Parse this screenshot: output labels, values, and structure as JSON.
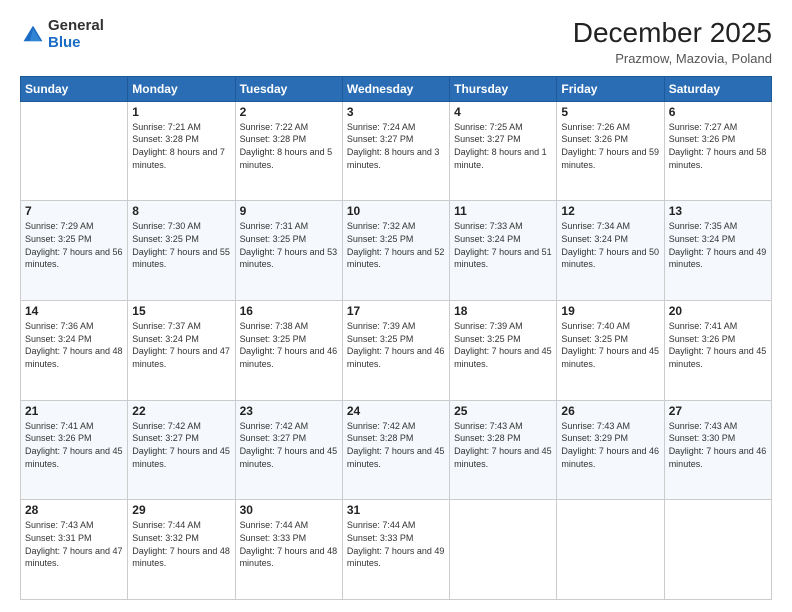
{
  "logo": {
    "general": "General",
    "blue": "Blue"
  },
  "title": "December 2025",
  "subtitle": "Prazmow, Mazovia, Poland",
  "days": [
    "Sunday",
    "Monday",
    "Tuesday",
    "Wednesday",
    "Thursday",
    "Friday",
    "Saturday"
  ],
  "weeks": [
    [
      {
        "day": "",
        "sunrise": "",
        "sunset": "",
        "daylight": ""
      },
      {
        "day": "1",
        "sunrise": "Sunrise: 7:21 AM",
        "sunset": "Sunset: 3:28 PM",
        "daylight": "Daylight: 8 hours and 7 minutes."
      },
      {
        "day": "2",
        "sunrise": "Sunrise: 7:22 AM",
        "sunset": "Sunset: 3:28 PM",
        "daylight": "Daylight: 8 hours and 5 minutes."
      },
      {
        "day": "3",
        "sunrise": "Sunrise: 7:24 AM",
        "sunset": "Sunset: 3:27 PM",
        "daylight": "Daylight: 8 hours and 3 minutes."
      },
      {
        "day": "4",
        "sunrise": "Sunrise: 7:25 AM",
        "sunset": "Sunset: 3:27 PM",
        "daylight": "Daylight: 8 hours and 1 minute."
      },
      {
        "day": "5",
        "sunrise": "Sunrise: 7:26 AM",
        "sunset": "Sunset: 3:26 PM",
        "daylight": "Daylight: 7 hours and 59 minutes."
      },
      {
        "day": "6",
        "sunrise": "Sunrise: 7:27 AM",
        "sunset": "Sunset: 3:26 PM",
        "daylight": "Daylight: 7 hours and 58 minutes."
      }
    ],
    [
      {
        "day": "7",
        "sunrise": "Sunrise: 7:29 AM",
        "sunset": "Sunset: 3:25 PM",
        "daylight": "Daylight: 7 hours and 56 minutes."
      },
      {
        "day": "8",
        "sunrise": "Sunrise: 7:30 AM",
        "sunset": "Sunset: 3:25 PM",
        "daylight": "Daylight: 7 hours and 55 minutes."
      },
      {
        "day": "9",
        "sunrise": "Sunrise: 7:31 AM",
        "sunset": "Sunset: 3:25 PM",
        "daylight": "Daylight: 7 hours and 53 minutes."
      },
      {
        "day": "10",
        "sunrise": "Sunrise: 7:32 AM",
        "sunset": "Sunset: 3:25 PM",
        "daylight": "Daylight: 7 hours and 52 minutes."
      },
      {
        "day": "11",
        "sunrise": "Sunrise: 7:33 AM",
        "sunset": "Sunset: 3:24 PM",
        "daylight": "Daylight: 7 hours and 51 minutes."
      },
      {
        "day": "12",
        "sunrise": "Sunrise: 7:34 AM",
        "sunset": "Sunset: 3:24 PM",
        "daylight": "Daylight: 7 hours and 50 minutes."
      },
      {
        "day": "13",
        "sunrise": "Sunrise: 7:35 AM",
        "sunset": "Sunset: 3:24 PM",
        "daylight": "Daylight: 7 hours and 49 minutes."
      }
    ],
    [
      {
        "day": "14",
        "sunrise": "Sunrise: 7:36 AM",
        "sunset": "Sunset: 3:24 PM",
        "daylight": "Daylight: 7 hours and 48 minutes."
      },
      {
        "day": "15",
        "sunrise": "Sunrise: 7:37 AM",
        "sunset": "Sunset: 3:24 PM",
        "daylight": "Daylight: 7 hours and 47 minutes."
      },
      {
        "day": "16",
        "sunrise": "Sunrise: 7:38 AM",
        "sunset": "Sunset: 3:25 PM",
        "daylight": "Daylight: 7 hours and 46 minutes."
      },
      {
        "day": "17",
        "sunrise": "Sunrise: 7:39 AM",
        "sunset": "Sunset: 3:25 PM",
        "daylight": "Daylight: 7 hours and 46 minutes."
      },
      {
        "day": "18",
        "sunrise": "Sunrise: 7:39 AM",
        "sunset": "Sunset: 3:25 PM",
        "daylight": "Daylight: 7 hours and 45 minutes."
      },
      {
        "day": "19",
        "sunrise": "Sunrise: 7:40 AM",
        "sunset": "Sunset: 3:25 PM",
        "daylight": "Daylight: 7 hours and 45 minutes."
      },
      {
        "day": "20",
        "sunrise": "Sunrise: 7:41 AM",
        "sunset": "Sunset: 3:26 PM",
        "daylight": "Daylight: 7 hours and 45 minutes."
      }
    ],
    [
      {
        "day": "21",
        "sunrise": "Sunrise: 7:41 AM",
        "sunset": "Sunset: 3:26 PM",
        "daylight": "Daylight: 7 hours and 45 minutes."
      },
      {
        "day": "22",
        "sunrise": "Sunrise: 7:42 AM",
        "sunset": "Sunset: 3:27 PM",
        "daylight": "Daylight: 7 hours and 45 minutes."
      },
      {
        "day": "23",
        "sunrise": "Sunrise: 7:42 AM",
        "sunset": "Sunset: 3:27 PM",
        "daylight": "Daylight: 7 hours and 45 minutes."
      },
      {
        "day": "24",
        "sunrise": "Sunrise: 7:42 AM",
        "sunset": "Sunset: 3:28 PM",
        "daylight": "Daylight: 7 hours and 45 minutes."
      },
      {
        "day": "25",
        "sunrise": "Sunrise: 7:43 AM",
        "sunset": "Sunset: 3:28 PM",
        "daylight": "Daylight: 7 hours and 45 minutes."
      },
      {
        "day": "26",
        "sunrise": "Sunrise: 7:43 AM",
        "sunset": "Sunset: 3:29 PM",
        "daylight": "Daylight: 7 hours and 46 minutes."
      },
      {
        "day": "27",
        "sunrise": "Sunrise: 7:43 AM",
        "sunset": "Sunset: 3:30 PM",
        "daylight": "Daylight: 7 hours and 46 minutes."
      }
    ],
    [
      {
        "day": "28",
        "sunrise": "Sunrise: 7:43 AM",
        "sunset": "Sunset: 3:31 PM",
        "daylight": "Daylight: 7 hours and 47 minutes."
      },
      {
        "day": "29",
        "sunrise": "Sunrise: 7:44 AM",
        "sunset": "Sunset: 3:32 PM",
        "daylight": "Daylight: 7 hours and 48 minutes."
      },
      {
        "day": "30",
        "sunrise": "Sunrise: 7:44 AM",
        "sunset": "Sunset: 3:33 PM",
        "daylight": "Daylight: 7 hours and 48 minutes."
      },
      {
        "day": "31",
        "sunrise": "Sunrise: 7:44 AM",
        "sunset": "Sunset: 3:33 PM",
        "daylight": "Daylight: 7 hours and 49 minutes."
      },
      {
        "day": "",
        "sunrise": "",
        "sunset": "",
        "daylight": ""
      },
      {
        "day": "",
        "sunrise": "",
        "sunset": "",
        "daylight": ""
      },
      {
        "day": "",
        "sunrise": "",
        "sunset": "",
        "daylight": ""
      }
    ]
  ]
}
